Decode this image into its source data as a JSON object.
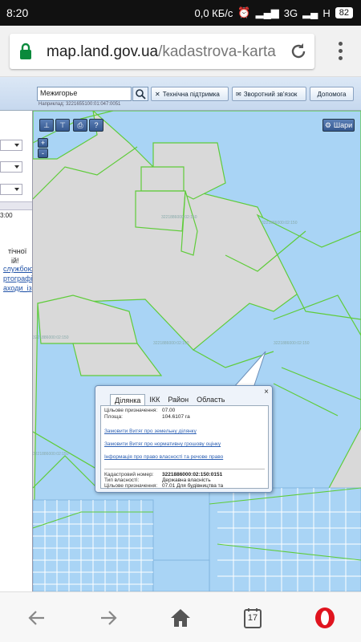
{
  "status": {
    "time": "8:20",
    "speed": "0,0 КБ/с",
    "network": "3G",
    "network2": "H",
    "battery": "82"
  },
  "browser": {
    "url_host": "map.land.gov.ua",
    "url_path": "/kadastrova-karta",
    "tab_count": "17"
  },
  "toolbar": {
    "search_value": "Межигорье",
    "search_hint": "Наприклад: 3221655100:01:047:0051",
    "support_label": "Технічна підтримка",
    "feedback_label": "Зворотний зв'язок",
    "help_label": "Допомога"
  },
  "map_controls": {
    "layers_label": "Шари",
    "zoom_in": "+",
    "zoom_out": "-"
  },
  "left_panel": {
    "time_text": "3:00",
    "text_lines": [
      "тічної",
      "ій!"
    ],
    "link_lines": [
      "службою",
      "ртографії",
      "аходи_із"
    ]
  },
  "map_labels": [
    "3221886000:02:150",
    "3221886000:02:150",
    "3221886000:02:150",
    "3221886000:02:150",
    "3221886000:02:150",
    "3221886000:02:150"
  ],
  "popup": {
    "close": "×",
    "tabs": [
      "Ділянка",
      "ІКК",
      "Район",
      "Область"
    ],
    "purpose_label": "Цільове призначення:",
    "purpose_value": "07.00",
    "area_label": "Площа:",
    "area_value": "104.6107 га",
    "link1": "Замовити Витяг про земельну ділянку",
    "link2": "Замовити Витяг про нормативну грошову оцінку",
    "link3": "Інформація про право власності та речове право",
    "cadastral_label": "Кадастровий номер:",
    "cadastral_value": "3221886000:02:150:0151",
    "ownership_label": "Тип власності:",
    "ownership_value": "Державна власність",
    "purpose2_label": "Цільове призначення:",
    "purpose2_value": "07.01 Для будівництва та"
  },
  "colors": {
    "parcel_fill": "#a9d4f5",
    "parcel_stroke": "#5fcc3a",
    "map_bg": "#d9d9d9",
    "opera_red": "#e0141f"
  }
}
